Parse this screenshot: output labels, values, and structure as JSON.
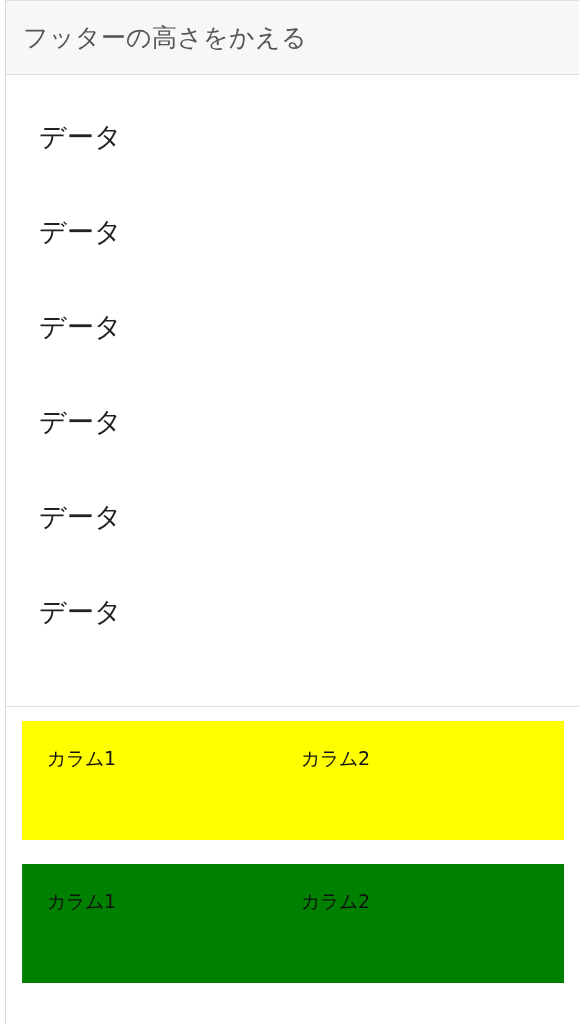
{
  "header": {
    "title": "フッターの高さをかえる"
  },
  "items": [
    {
      "label": "データ"
    },
    {
      "label": "データ"
    },
    {
      "label": "データ"
    },
    {
      "label": "データ"
    },
    {
      "label": "データ"
    },
    {
      "label": "データ"
    }
  ],
  "footer": {
    "rows": [
      {
        "color": "#ffff00",
        "columns": [
          "カラム1",
          "カラム2"
        ]
      },
      {
        "color": "#008000",
        "columns": [
          "カラム1",
          "カラム2"
        ]
      }
    ]
  }
}
